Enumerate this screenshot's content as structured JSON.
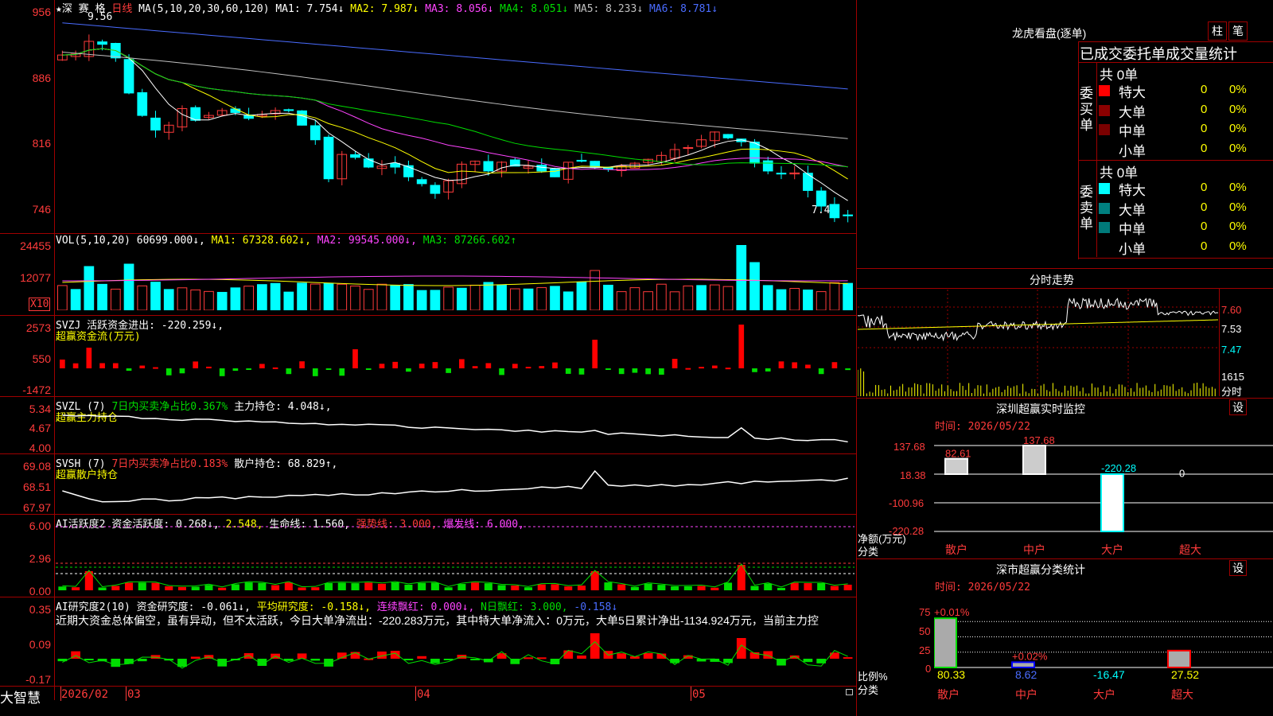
{
  "main_chart": {
    "header": {
      "symbol": "★深 赛 格",
      "period": "日线",
      "ma_desc": "MA(5,10,20,30,60,120)",
      "ma1": "MA1: 7.754↓",
      "ma2": "MA2: 7.987↓",
      "ma3": "MA3: 8.056↓",
      "ma4": "MA4: 8.051↓",
      "ma5": "MA5: 8.233↓",
      "ma6": "MA6: 8.781↓"
    },
    "y_labels": [
      "956",
      "886",
      "816",
      "746"
    ],
    "high_label": "9.56",
    "low_label": "7.46",
    "colors": {
      "up": "#ff3b3b",
      "down": "#00ffff",
      "ma1": "#ffffff",
      "ma2": "#ffff00",
      "ma3": "#ff44ff",
      "ma4": "#00dd00",
      "ma5": "#c0c0c0",
      "ma6": "#4a6cff"
    }
  },
  "vol_panel": {
    "header": {
      "name": "VOL(5,10,20)",
      "value": "60699.000↓,",
      "ma1": "MA1: 67328.602↓,",
      "ma2": "MA2: 99545.000↓,",
      "ma3": "MA3: 87266.602↑"
    },
    "y_labels": [
      "24455",
      "12077"
    ],
    "unit": "X10"
  },
  "svzj_panel": {
    "header": {
      "name": "SVZJ",
      "desc": "活跃资金进出: -220.259↓,",
      "sub": "超赢资金流(万元)"
    },
    "y_labels": [
      "2573",
      "550",
      "-1472"
    ]
  },
  "svzl_panel": {
    "header": {
      "name": "SVZL (7)",
      "ratio": "7日内买卖净占比0.367%",
      "hold": "主力持仓: 4.048↓,",
      "sub": "超赢主力持仓"
    },
    "y_labels": [
      "5.34",
      "4.67",
      "4.00"
    ]
  },
  "svsh_panel": {
    "header": {
      "name": "SVSH (7)",
      "ratio": "7日内买卖净占比0.183%",
      "hold": "散户持仓: 68.829↑,",
      "sub": "超赢散户持仓"
    },
    "y_labels": [
      "69.08",
      "68.51",
      "67.97"
    ]
  },
  "ai_active_panel": {
    "header": {
      "name": "AI活跃度2",
      "a": "资金活跃度: 0.268↓,",
      "b": "2.548,",
      "c": "生命线: 1.560,",
      "d": "强势线: 3.000,",
      "e": "爆发线: 6.000,"
    },
    "y_labels": [
      "6.00",
      "2.96",
      "0.00"
    ]
  },
  "ai_research_panel": {
    "header": {
      "name": "AI研究度2(10)",
      "a": "资金研究度: -0.061↓,",
      "b": "平均研究度: -0.158↓,",
      "c": "连续飘红: 0.000↓,",
      "d": "N日飘红: 3.000,",
      "e": "-0.158↓"
    },
    "text": "近期大资金总体偏空，虽有异动，但不太活跃，今日大单净流出：-220.283万元，其中特大单净流入：0万元，大单5日累计净出-1134.924万元，当前主力控",
    "y_labels": [
      "0.35",
      "0.09",
      "-0.17"
    ]
  },
  "x_axis": {
    "year_month": "2026/02",
    "m3": "03",
    "m4": "04",
    "m5": "05",
    "brand": "大智慧"
  },
  "right_panel": {
    "dragon_title": "龙虎看盘(逐单)",
    "btn_bar": "柱",
    "btn_pen": "笔",
    "tab_text": "已成交委托单成交量统计",
    "buy_group": {
      "side": "委买单",
      "total": "共 0单",
      "rows": [
        {
          "label": "特大",
          "val": "0",
          "pct": "0%",
          "color": "#ff0000"
        },
        {
          "label": "大单",
          "val": "0",
          "pct": "0%",
          "color": "#8b0000"
        },
        {
          "label": "中单",
          "val": "0",
          "pct": "0%",
          "color": "#7a0000"
        },
        {
          "label": "小单",
          "val": "0",
          "pct": "0%",
          "color": ""
        }
      ]
    },
    "sell_group": {
      "side": "委卖单",
      "total": "共 0单",
      "rows": [
        {
          "label": "特大",
          "val": "0",
          "pct": "0%",
          "color": "#00ffff"
        },
        {
          "label": "大单",
          "val": "0",
          "pct": "0%",
          "color": "#008080"
        },
        {
          "label": "中单",
          "val": "0",
          "pct": "0%",
          "color": "#007a7a"
        },
        {
          "label": "小单",
          "val": "0",
          "pct": "0%",
          "color": ""
        }
      ]
    },
    "intraday": {
      "title": "分时走势",
      "p1": "7.60",
      "p2": "7.53",
      "p3": "7.47",
      "vol": "1615",
      "vol_unit": "分时"
    },
    "monitor": {
      "title": "深圳超赢实时监控",
      "set": "设",
      "time": "时间: 2026/05/22",
      "y_labels": [
        "137.68",
        "18.38",
        "-100.96",
        "-220.28"
      ],
      "y_unit": "净额(万元)",
      "x_unit": "分类",
      "bars": [
        {
          "cat": "散户",
          "value": 82.61,
          "label": "82.61"
        },
        {
          "cat": "中户",
          "value": 137.68,
          "label": "137.68"
        },
        {
          "cat": "大户",
          "value": -220.28,
          "label": "-220.28"
        },
        {
          "cat": "超大",
          "value": 0,
          "label": "0"
        }
      ]
    },
    "classify": {
      "title": "深市超赢分类统计",
      "set": "设",
      "time": "时间: 2026/05/22",
      "y_labels": [
        "75",
        "50",
        "25",
        "0"
      ],
      "y_unit": "比例%",
      "x_unit": "分类",
      "bars": [
        {
          "cat": "散户",
          "value": 80.33,
          "top": "+0.01%",
          "bottom": "80.33"
        },
        {
          "cat": "中户",
          "value": 8.62,
          "top": "+0.02%",
          "bottom": "8.62"
        },
        {
          "cat": "大户",
          "value": -16.47,
          "top": "",
          "bottom": "-16.47"
        },
        {
          "cat": "超大",
          "value": 27.52,
          "top": "",
          "bottom": "27.52"
        }
      ]
    }
  }
}
